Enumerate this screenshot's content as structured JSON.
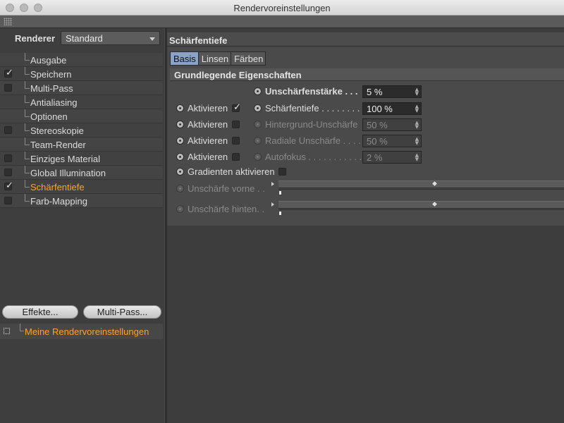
{
  "window": {
    "title": "Rendervoreinstellungen"
  },
  "renderer": {
    "label": "Renderer",
    "value": "Standard"
  },
  "settings_list": [
    {
      "label": "Ausgabe",
      "has_checkbox": false,
      "checked": false,
      "active": false
    },
    {
      "label": "Speichern",
      "has_checkbox": true,
      "checked": true,
      "active": false
    },
    {
      "label": "Multi-Pass",
      "has_checkbox": true,
      "checked": false,
      "active": false
    },
    {
      "label": "Antialiasing",
      "has_checkbox": false,
      "checked": false,
      "active": false
    },
    {
      "label": "Optionen",
      "has_checkbox": false,
      "checked": false,
      "active": false
    },
    {
      "label": "Stereoskopie",
      "has_checkbox": true,
      "checked": false,
      "active": false
    },
    {
      "label": "Team-Render",
      "has_checkbox": false,
      "checked": false,
      "active": false
    },
    {
      "label": "Einziges Material",
      "has_checkbox": true,
      "checked": false,
      "active": false
    },
    {
      "label": "Global Illumination",
      "has_checkbox": true,
      "checked": false,
      "active": false
    },
    {
      "label": "Schärfentiefe",
      "has_checkbox": true,
      "checked": true,
      "active": true
    },
    {
      "label": "Farb-Mapping",
      "has_checkbox": true,
      "checked": false,
      "active": false
    }
  ],
  "buttons": {
    "effects": "Effekte...",
    "multipass": "Multi-Pass..."
  },
  "preset": {
    "label": "Meine Rendervoreinstellungen"
  },
  "section": {
    "title": "Schärfentiefe"
  },
  "tabs": [
    {
      "label": "Basis",
      "active": true
    },
    {
      "label": "Linsen",
      "active": false
    },
    {
      "label": "Färben",
      "active": false
    }
  ],
  "group": {
    "title": "Grundlegende Eigenschaften"
  },
  "blur_strength": {
    "label": "Unschärfenstärke . . .",
    "value": "5 %"
  },
  "params": [
    {
      "activate_label": "Aktivieren",
      "activate_checked": true,
      "label": "Schärfentiefe . . . . . . . . .",
      "value": "100 %",
      "enabled": true
    },
    {
      "activate_label": "Aktivieren",
      "activate_checked": false,
      "label": "Hintergrund-Unschärfe",
      "value": "50 %",
      "enabled": false
    },
    {
      "activate_label": "Aktivieren",
      "activate_checked": false,
      "label": "Radiale Unschärfe . . . .",
      "value": "50 %",
      "enabled": false
    },
    {
      "activate_label": "Aktivieren",
      "activate_checked": false,
      "label": "Autofokus . . . . . . . . . . . .",
      "value": "2 %",
      "enabled": false
    }
  ],
  "gradients": {
    "label": "Gradienten aktivieren",
    "checked": false
  },
  "gradient_rows": [
    {
      "label": "Unschärfe vorne . .",
      "enabled": false
    },
    {
      "label": "Unschärfe hinten. .",
      "enabled": false
    }
  ]
}
